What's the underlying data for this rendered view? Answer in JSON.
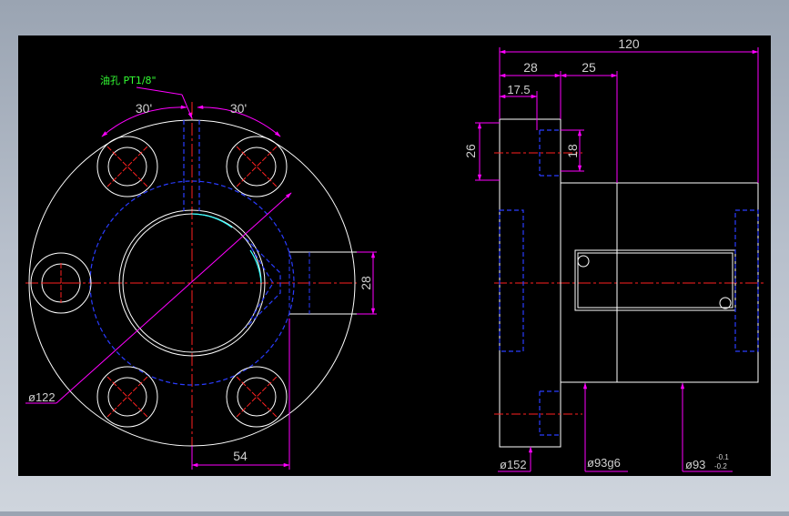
{
  "drawing": {
    "note": "油孔 PT1/8\"",
    "angle_left": "30'",
    "angle_right": "30'",
    "dia_122": "ø122",
    "dim_54": "54",
    "dim_28_front": "28",
    "dim_120": "120",
    "dim_28_top": "28",
    "dim_25": "25",
    "dim_17_5": "17.5",
    "dim_26": "26",
    "dim_18": "18",
    "dia_152": "ø152",
    "dia_93g6": "ø93g6",
    "dia_93": "ø93",
    "tol_upper": "-0.1",
    "tol_lower": "-0.2"
  },
  "colors": {
    "background_canvas": "#000000",
    "outline": "#ffffff",
    "centerline": "#ff2020",
    "hidden": "#2a3cff",
    "dimension": "#ff00ff",
    "dimension_text": "#cfcfcf",
    "note_text": "#33ff33",
    "tangent": "#33ffff"
  }
}
